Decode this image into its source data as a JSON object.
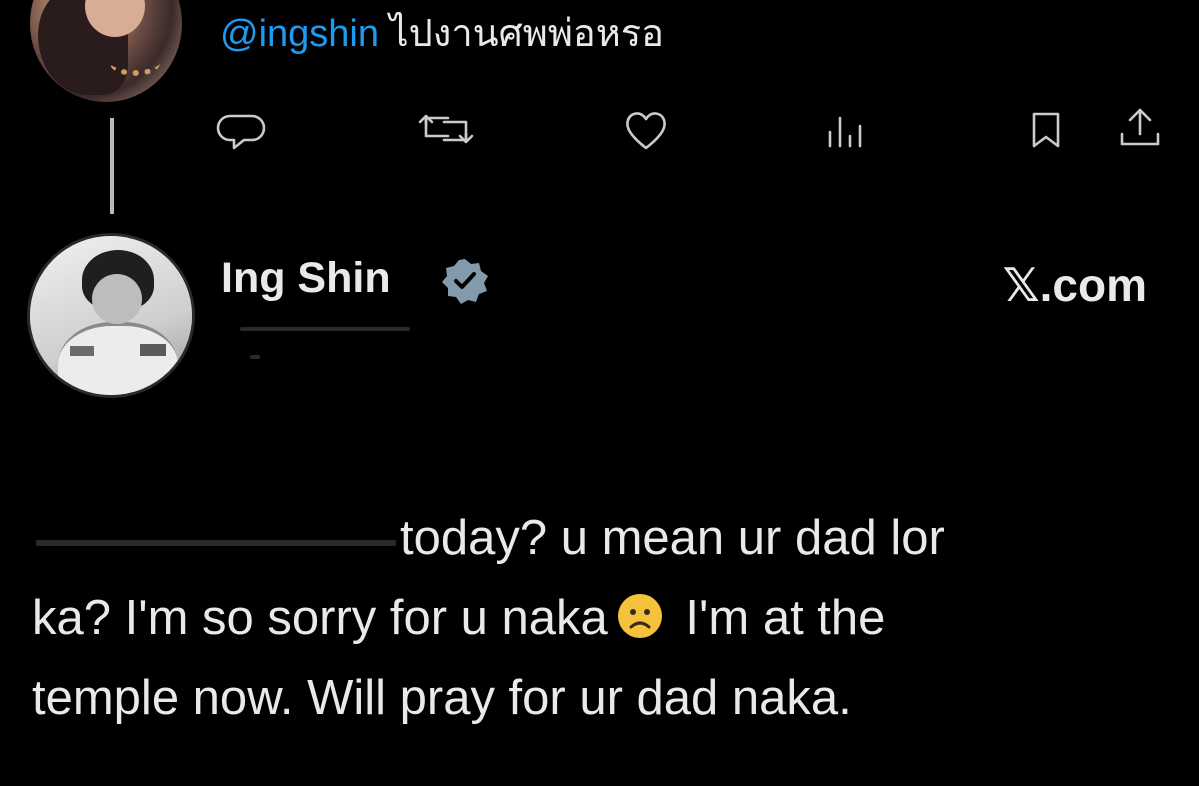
{
  "reply": {
    "mention": "@ingshin",
    "text": " ไปงานศพพ่อหรอ"
  },
  "actions": {
    "reply_icon": "reply-icon",
    "repost_icon": "repost-icon",
    "like_icon": "heart-icon",
    "views_icon": "views-icon",
    "bookmark_icon": "bookmark-icon",
    "share_icon": "share-icon"
  },
  "tweet": {
    "author_name": "Ing Shin",
    "verified": true,
    "source": "𝕏.com",
    "lines": [
      "today? u mean ur dad lor",
      "ka? I'm so sorry for u naka",
      " I'm at the",
      "temple now. Will pray for ur dad naka."
    ],
    "emoji": "frowning-face-emoji"
  },
  "colors": {
    "background": "#000000",
    "text": "#e7e9ea",
    "mention": "#1d9bf0",
    "verified_badge": "#829aab"
  }
}
